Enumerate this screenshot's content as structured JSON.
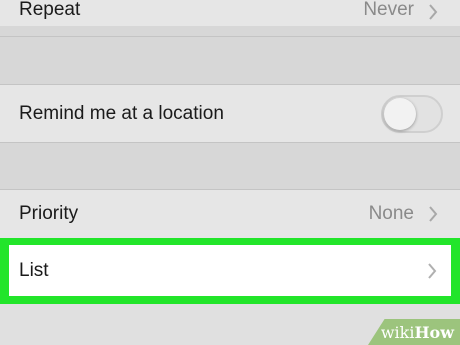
{
  "rows": {
    "repeat": {
      "label": "Repeat",
      "value": "Never"
    },
    "remind_location": {
      "label": "Remind me at a location",
      "toggle_state": "off"
    },
    "priority": {
      "label": "Priority",
      "value": "None"
    },
    "list": {
      "label": "List"
    }
  },
  "highlight_color": "#22e52a",
  "watermark": {
    "wiki": "wiki",
    "how": "How"
  }
}
